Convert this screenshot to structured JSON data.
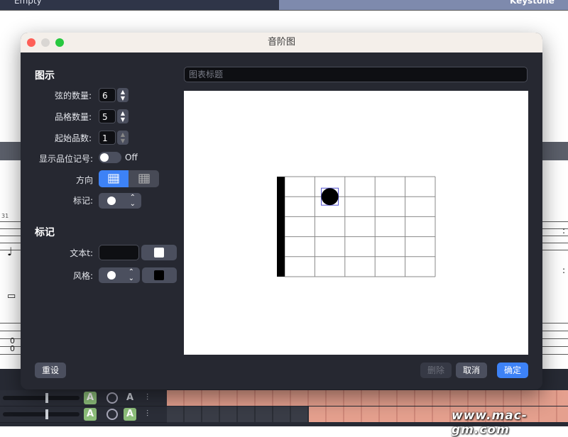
{
  "background": {
    "top_left_label": "Empty",
    "top_right_label": "Keystone",
    "measure_number": "31",
    "tab_numbers": [
      "0",
      "0"
    ],
    "track_button_letter": "A",
    "watermark": "www.mac-gm.com"
  },
  "dialog": {
    "title": "音阶图",
    "diagram_section": {
      "heading": "图示",
      "strings_label": "弦的数量:",
      "strings_value": "6",
      "frets_label": "品格数量:",
      "frets_value": "5",
      "start_fret_label": "起始品数:",
      "start_fret_value": "1",
      "show_fret_label": "显示品位记号:",
      "show_fret_state": "Off",
      "orientation_label": "方向",
      "marker_label": "标记:"
    },
    "marker_section": {
      "heading": "标记",
      "text_label": "文本t:",
      "style_label": "风格:"
    },
    "chart_title_placeholder": "图表标题",
    "diagram": {
      "strings": 6,
      "frets": 5,
      "dots": [
        {
          "string": 2,
          "fret": 2
        }
      ],
      "colors": {
        "grid": "#888888",
        "nut": "#000000",
        "dot": "#000000",
        "selection": "#5050d0"
      }
    },
    "buttons": {
      "reset": "重设",
      "delete": "删除",
      "cancel": "取消",
      "ok": "确定"
    },
    "colors": {
      "accent": "#3d82f6",
      "dialog_bg": "#262831",
      "control_bg": "#4b4f5e"
    }
  }
}
